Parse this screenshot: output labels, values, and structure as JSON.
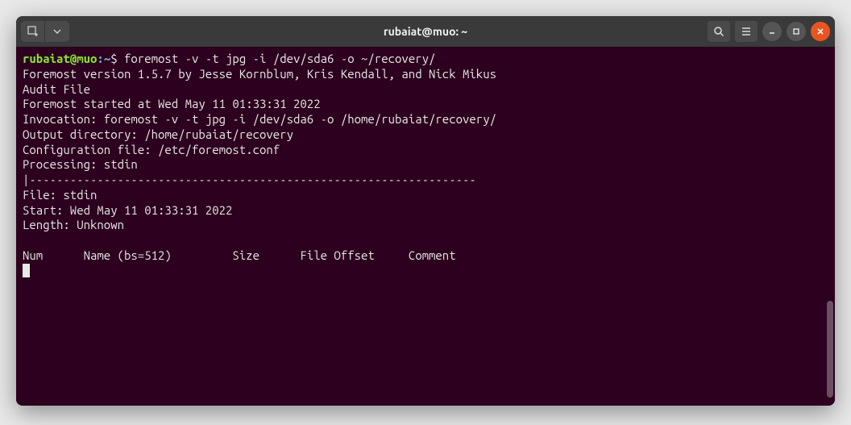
{
  "titlebar": {
    "title": "rubaiat@muo: ~"
  },
  "prompt": {
    "user": "rubaiat@muo",
    "sep": ":",
    "path": "~",
    "dollar": "$",
    "command": "foremost -v -t jpg -i /dev/sda6 -o ~/recovery/"
  },
  "lines": {
    "l1": "Foremost version 1.5.7 by Jesse Kornblum, Kris Kendall, and Nick Mikus",
    "l2": "Audit File",
    "l3": "",
    "l4": "Foremost started at Wed May 11 01:33:31 2022",
    "l5": "Invocation: foremost -v -t jpg -i /dev/sda6 -o /home/rubaiat/recovery/",
    "l6": "Output directory: /home/rubaiat/recovery",
    "l7": "Configuration file: /etc/foremost.conf",
    "l8": "Processing: stdin",
    "l9": "|------------------------------------------------------------------",
    "l10": "File: stdin",
    "l11": "Start: Wed May 11 01:33:31 2022",
    "l12": "Length: Unknown",
    "l13": " ",
    "l14": "Num      Name (bs=512)         Size      File Offset     Comment ",
    "l15": ""
  }
}
